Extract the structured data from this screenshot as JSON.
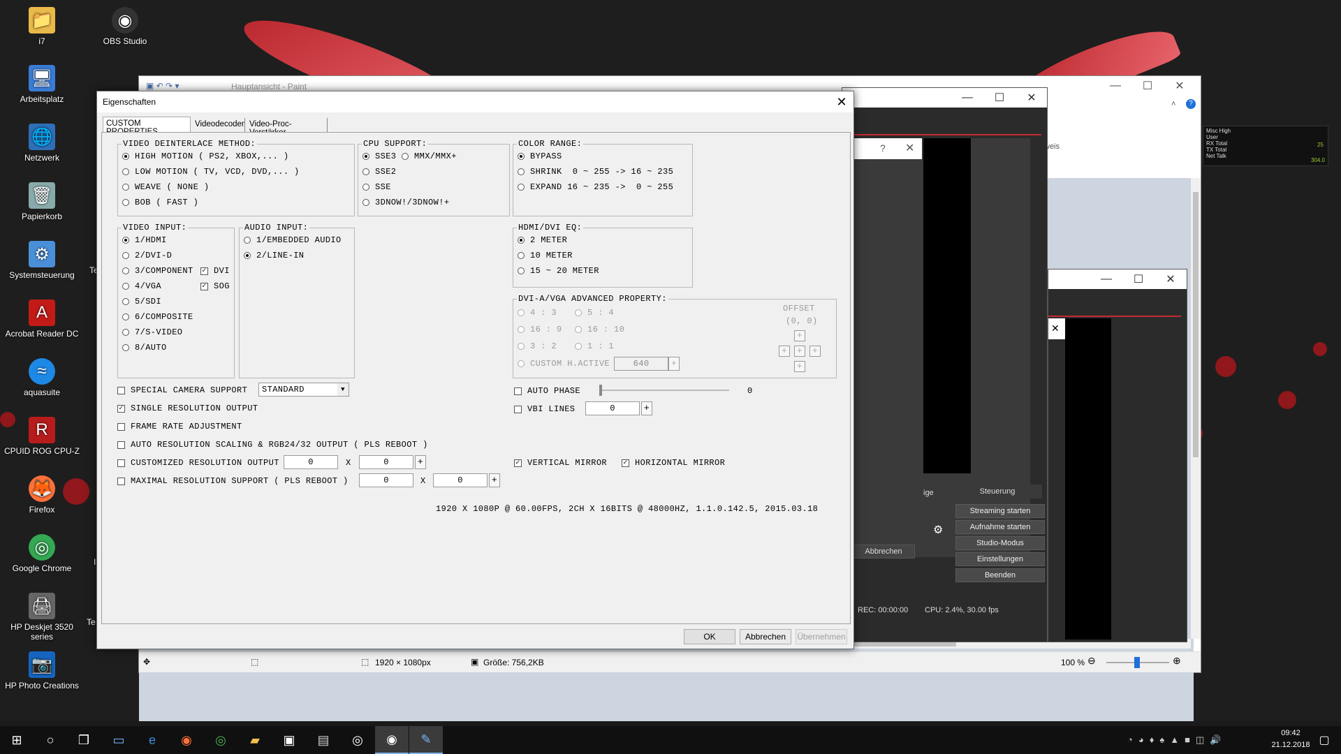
{
  "desktop": {
    "icons": [
      {
        "label": "i7",
        "glyph": "📁"
      },
      {
        "label": "OBS Studio",
        "glyph": "◉"
      },
      {
        "label": "Arbeitsplatz",
        "glyph": "🖥"
      },
      {
        "label": "Netzwerk",
        "glyph": "🌐"
      },
      {
        "label": "Papierkorb",
        "glyph": "🗑"
      },
      {
        "label": "Systemsteuerung",
        "glyph": "⚙"
      },
      {
        "label": "Acrobat Reader DC",
        "glyph": "A"
      },
      {
        "label": "aquasuite",
        "glyph": "≈"
      },
      {
        "label": "CPUID ROG CPU-Z",
        "glyph": "R"
      },
      {
        "label": "Firefox",
        "glyph": "🦊"
      },
      {
        "label": "Google Chrome",
        "glyph": "◎"
      },
      {
        "label": "HP Deskjet 3520 series",
        "glyph": "🖨"
      },
      {
        "label": "HP Photo Creations",
        "glyph": "📷"
      }
    ],
    "partial_te1": "Te",
    "partial_te2": "Te",
    "partial_l": "I"
  },
  "paint": {
    "title": "Hauptansicht - Paint",
    "status_size": "1920 × 1080px",
    "status_file": "Größe: 756,2KB",
    "zoom": "100 %",
    "ribbon_text": "weis"
  },
  "obs": {
    "steuerung": "Steuerung",
    "streaming": "Streaming starten",
    "aufnahme": "Aufnahme starten",
    "studio": "Studio-Modus",
    "einstellungen": "Einstellungen",
    "beenden": "Beenden",
    "abbrechen": "Abbrechen",
    "ige": "ige",
    "rec": "REC: 00:00:00",
    "cpu": "CPU: 2.4%, 30.00 fps",
    "help_q": "?"
  },
  "gadget": {
    "lines": [
      "Misc High",
      "User",
      "RX Total",
      "TX Total",
      "Net Talk"
    ],
    "v1": "25",
    "v2": "304.0"
  },
  "dialog": {
    "title": "Eigenschaften",
    "tabs": [
      "CUSTOM PROPERTIES",
      "Videodecoder",
      "Video-Proc-Verstärker"
    ],
    "deint": {
      "label": "VIDEO DEINTERLACE METHOD:",
      "options": [
        "HIGH MOTION ( PS2, XBOX,... )",
        "LOW MOTION ( TV, VCD, DVD,... )",
        "WEAVE ( NONE )",
        "BOB ( FAST )"
      ]
    },
    "cpu": {
      "label": "CPU SUPPORT:",
      "options": [
        "SSE3",
        "MMX/MMX+",
        "SSE2",
        "SSE",
        "3DNOW!/3DNOW!+"
      ]
    },
    "color": {
      "label": "COLOR RANGE:",
      "options": [
        "BYPASS",
        "SHRINK  0 ~ 255 -> 16 ~ 235",
        "EXPAND 16 ~ 235 ->  0 ~ 255"
      ]
    },
    "vin": {
      "label": "VIDEO INPUT:",
      "options": [
        "1/HDMI",
        "2/DVI-D",
        "3/COMPONENT",
        "4/VGA",
        "5/SDI",
        "6/COMPOSITE",
        "7/S-VIDEO",
        "8/AUTO"
      ],
      "dvi": "DVI",
      "sog": "SOG"
    },
    "ain": {
      "label": "AUDIO INPUT:",
      "options": [
        "1/EMBEDDED AUDIO",
        "2/LINE-IN"
      ]
    },
    "hdmi": {
      "label": "HDMI/DVI EQ:",
      "options": [
        "2 METER",
        "10 METER",
        "15 ~ 20 METER"
      ]
    },
    "adv": {
      "label": "DVI-A/VGA ADVANCED PROPERTY:",
      "r43": "4 : 3",
      "r54": "5 : 4",
      "r169": "16 : 9",
      "r1610": "16 : 10",
      "r32": "3 : 2",
      "r11": "1 : 1",
      "custom": "CUSTOM H.ACTIVE",
      "custom_val": "640",
      "offset": "OFFSET",
      "offset_val": "(0, 0)"
    },
    "special": "SPECIAL CAMERA SUPPORT",
    "special_sel": "STANDARD",
    "single": "SINGLE RESOLUTION OUTPUT",
    "frame": "FRAME RATE ADJUSTMENT",
    "autores": "AUTO RESOLUTION SCALING & RGB24/32 OUTPUT ( PLS REBOOT )",
    "custres": "CUSTOMIZED RESOLUTION OUTPUT",
    "custres_w": "0",
    "custres_h": "0",
    "maxres": "MAXIMAL RESOLUTION SUPPORT ( PLS REBOOT )",
    "maxres_w": "0",
    "maxres_h": "0",
    "x": "X",
    "autophase": "AUTO PHASE",
    "autophase_val": "0",
    "vbi": "VBI LINES",
    "vbi_val": "0",
    "vmirror": "VERTICAL MIRROR",
    "hmirror": "HORIZONTAL MIRROR",
    "info": "1920 X 1080P @ 60.00FPS, 2CH X 16BITS @ 48000HZ, 1.1.0.142.5, 2015.03.18",
    "plus": "+",
    "ok": "OK",
    "cancel": "Abbrechen",
    "apply": "Übernehmen"
  },
  "taskbar": {
    "time": "09:42",
    "date": "21.12.2018"
  },
  "colors": {
    "accent": "#0078d7",
    "feather": "#c42a31"
  }
}
